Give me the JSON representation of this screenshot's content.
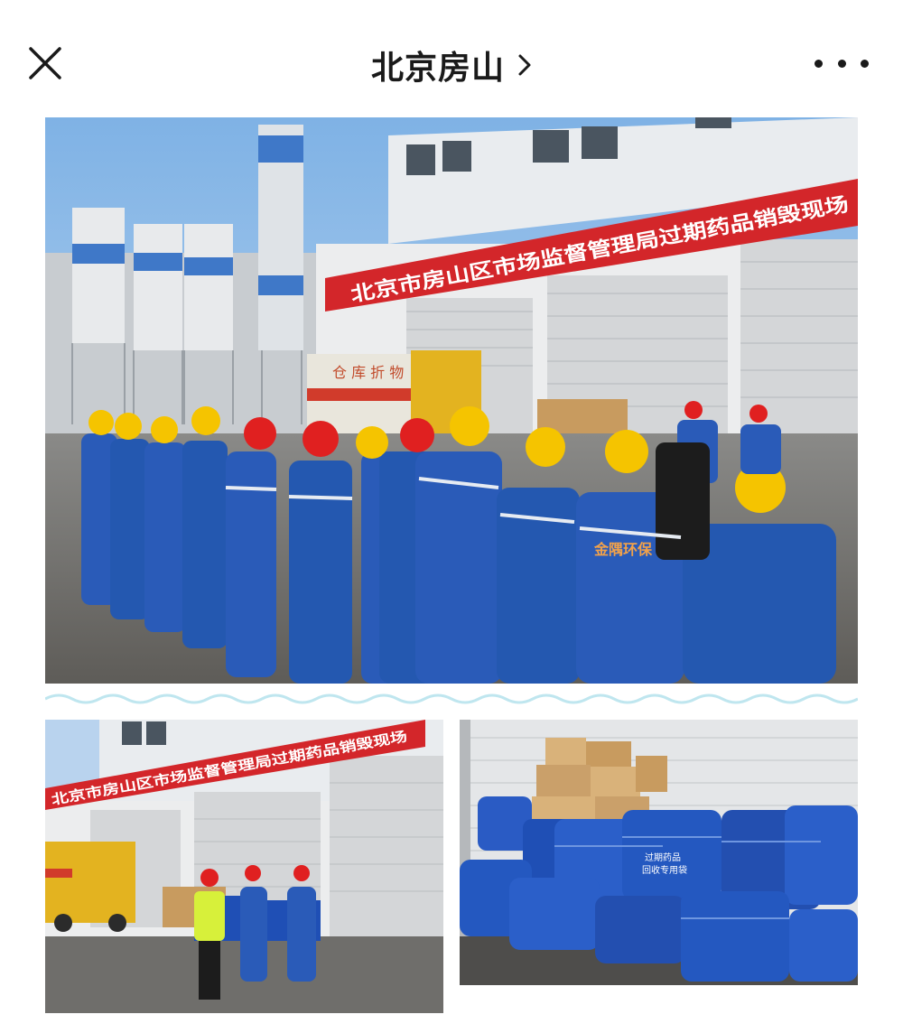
{
  "header": {
    "title": "北京房山",
    "chevron_icon": "chevron-right-icon",
    "close_icon": "close-icon",
    "more_icon": "more-horizontal-icon"
  },
  "photos": {
    "main": {
      "banner_text": "北京市房山区市场监督管理局过期药品销毁现场",
      "truck_text": "仓 库 折 物",
      "uniform_text": "金隅环保"
    },
    "bottom_left": {
      "banner_text": "北京市房山区市场监督管理局过期药品销毁现场"
    },
    "bottom_right": {
      "bag_text_1": "过期药品",
      "bag_text_2": "回收专用袋"
    }
  },
  "colors": {
    "banner_red": "#d3262a",
    "uniform_blue": "#2a5bb8",
    "helmet_yellow": "#f5c400",
    "helmet_red": "#e02020",
    "bag_blue": "#1f4fb5"
  }
}
